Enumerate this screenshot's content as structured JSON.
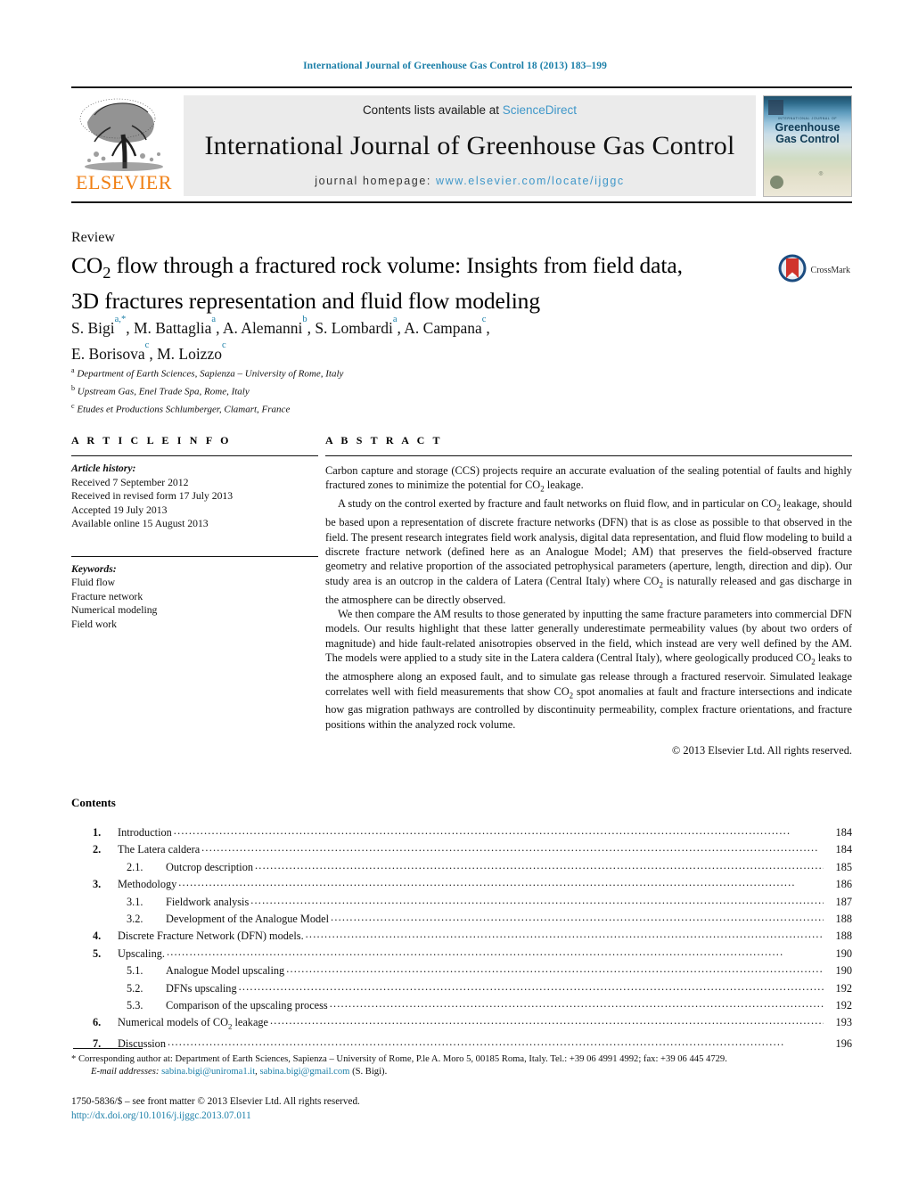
{
  "running_head": "International Journal of Greenhouse Gas Control 18 (2013) 183–199",
  "masthead": {
    "publisher_name": "ELSEVIER",
    "contents_prefix": "Contents lists available at ",
    "sciencedirect": "ScienceDirect",
    "journal_name": "International Journal of Greenhouse Gas Control",
    "homepage_prefix": "journal homepage: ",
    "homepage_url": "www.elsevier.com/locate/ijggc",
    "cover": {
      "superline": "INTERNATIONAL JOURNAL OF",
      "title": "Greenhouse Gas Control"
    },
    "link_color": "#3f97c9",
    "brand_color": "#f07f13"
  },
  "article": {
    "type": "Review",
    "title_line1": "CO2 flow through a fractured rock volume: Insights from field data,",
    "title_line2": "3D fractures representation and fluid flow modeling",
    "crossmark_label": "CrossMark",
    "authors_line1": "S. Bigi a,*, M. Battaglia a, A. Alemanni b, S. Lombardi a, A. Campana c,",
    "authors_line2": "E. Borisova c, M. Loizzo c",
    "affiliations": [
      {
        "mark": "a",
        "text": "Department of Earth Sciences, Sapienza – University of Rome, Italy"
      },
      {
        "mark": "b",
        "text": "Upstream Gas, Enel Trade Spa, Rome, Italy"
      },
      {
        "mark": "c",
        "text": "Etudes et Productions Schlumberger, Clamart, France"
      }
    ]
  },
  "info": {
    "heading": "A R T I C L E    I N F O",
    "history_label": "Article history:",
    "history": [
      "Received 7 September 2012",
      "Received in revised form 17 July 2013",
      "Accepted 19 July 2013",
      "Available online 15 August 2013"
    ],
    "keywords_label": "Keywords:",
    "keywords": [
      "Fluid flow",
      "Fracture network",
      "Numerical modeling",
      "Field work"
    ]
  },
  "abstract": {
    "heading": "A B S T R A C T",
    "paragraphs": [
      "Carbon capture and storage (CCS) projects require an accurate evaluation of the sealing potential of faults and highly fractured zones to minimize the potential for CO2 leakage.",
      "A study on the control exerted by fracture and fault networks on fluid flow, and in particular on CO2 leakage, should be based upon a representation of discrete fracture networks (DFN) that is as close as possible to that observed in the field. The present research integrates field work analysis, digital data representation, and fluid flow modeling to build a discrete fracture network (defined here as an Analogue Model; AM) that preserves the field-observed fracture geometry and relative proportion of the associated petrophysical parameters (aperture, length, direction and dip). Our study area is an outcrop in the caldera of Latera (Central Italy) where CO2 is naturally released and gas discharge in the atmosphere can be directly observed.",
      "We then compare the AM results to those generated by inputting the same fracture parameters into commercial DFN models. Our results highlight that these latter generally underestimate permeability values (by about two orders of magnitude) and hide fault-related anisotropies observed in the field, which instead are very well defined by the AM. The models were applied to a study site in the Latera caldera (Central Italy), where geologically produced CO2 leaks to the atmosphere along an exposed fault, and to simulate gas release through a fractured reservoir. Simulated leakage correlates well with field measurements that show CO2 spot anomalies at fault and fracture intersections and indicate how gas migration pathways are controlled by discontinuity permeability, complex fracture orientations, and fracture positions within the analyzed rock volume."
    ],
    "copyright": "© 2013 Elsevier Ltd. All rights reserved."
  },
  "contents": {
    "heading": "Contents",
    "entries": [
      {
        "num": "1.",
        "label": "Introduction",
        "page": "184",
        "level": 1
      },
      {
        "num": "2.",
        "label": "The Latera caldera",
        "page": "184",
        "level": 1
      },
      {
        "num": "2.1.",
        "label": "Outcrop description",
        "page": "185",
        "level": 2
      },
      {
        "num": "3.",
        "label": "Methodology",
        "page": "186",
        "level": 1
      },
      {
        "num": "3.1.",
        "label": "Fieldwork analysis",
        "page": "187",
        "level": 2
      },
      {
        "num": "3.2.",
        "label": "Development of the Analogue Model",
        "page": "188",
        "level": 2
      },
      {
        "num": "4.",
        "label": "Discrete Fracture Network (DFN) models.",
        "page": "188",
        "level": 1
      },
      {
        "num": "5.",
        "label": "Upscaling.",
        "page": "190",
        "level": 1
      },
      {
        "num": "5.1.",
        "label": "Analogue Model upscaling",
        "page": "190",
        "level": 2
      },
      {
        "num": "5.2.",
        "label": "DFNs upscaling",
        "page": "192",
        "level": 2
      },
      {
        "num": "5.3.",
        "label": "Comparison of the upscaling process",
        "page": "192",
        "level": 2
      },
      {
        "num": "6.",
        "label": "Numerical models of CO2 leakage",
        "page": "193",
        "level": 1
      },
      {
        "num": "7.",
        "label": "Discussion",
        "page": "196",
        "level": 1
      }
    ]
  },
  "footnote": {
    "corresponding": "* Corresponding author at: Department of Earth Sciences, Sapienza – University of Rome, P.le A. Moro 5, 00185 Roma, Italy. Tel.: +39 06 4991 4992; fax: +39 06 445 4729.",
    "email_label": "E-mail addresses:",
    "email1": "sabina.bigi@uniroma1.it",
    "email2": "sabina.bigi@gmail.com",
    "email_suffix": "(S. Bigi)."
  },
  "imprint": {
    "issn_line": "1750-5836/$ – see front matter © 2013 Elsevier Ltd. All rights reserved.",
    "doi": "http://dx.doi.org/10.1016/j.ijggc.2013.07.011"
  }
}
